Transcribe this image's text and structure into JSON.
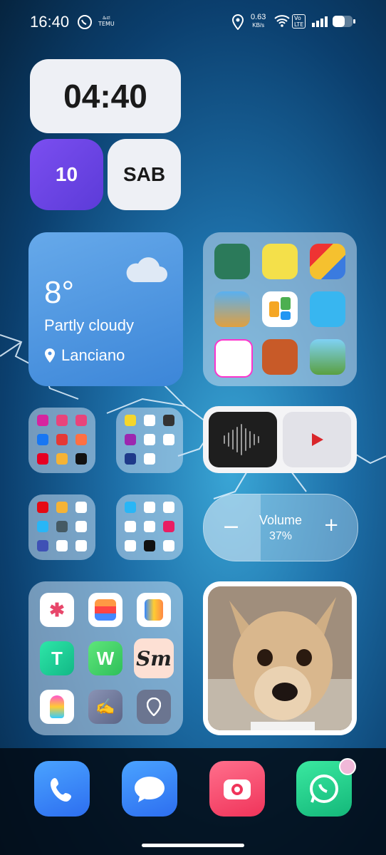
{
  "status_bar": {
    "time": "16:40",
    "tiny_line1": "ಹಿಪ",
    "tiny_line2": "TEMU",
    "speed_value": "0.63",
    "speed_unit": "KB/s",
    "volte_line1": "Vo",
    "volte_line2": "LTE"
  },
  "clock_widget": {
    "time": "04:40"
  },
  "date_widget": {
    "day": "10",
    "weekday": "SAB"
  },
  "weather": {
    "temperature": "8°",
    "condition": "Partly cloudy",
    "location": "Lanciano"
  },
  "volume": {
    "label": "Volume",
    "percent": "37%",
    "level": 0.37
  },
  "app_folder": {
    "sm_label": "Sm"
  },
  "colors": {
    "accent_purple": "#6b45e6",
    "weather_blue": "#4a90e2",
    "phone_blue": "#2d7cf6",
    "camera_pink": "#f24a6a",
    "whatsapp_green": "#1fcf8a"
  },
  "dock": [
    {
      "name": "Phone"
    },
    {
      "name": "Messages"
    },
    {
      "name": "Camera"
    },
    {
      "name": "WhatsApp"
    }
  ]
}
